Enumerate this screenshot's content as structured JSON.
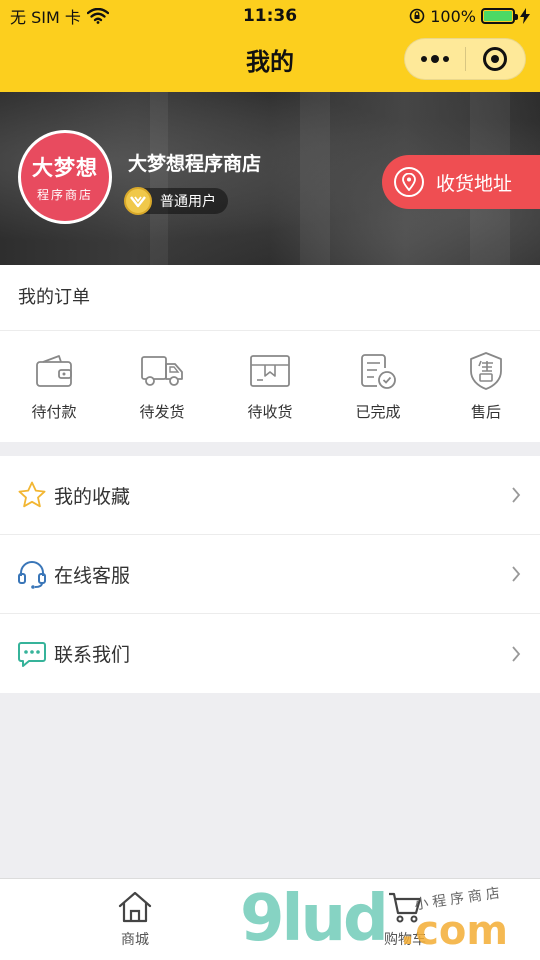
{
  "status_bar": {
    "carrier": "无 SIM 卡",
    "time": "11:36",
    "battery": "100%"
  },
  "nav": {
    "title": "我的"
  },
  "profile": {
    "avatar_line1": "大梦想",
    "avatar_line2": "程序商店",
    "name": "大梦想程序商店",
    "level": "普通用户",
    "address_button": "收货地址"
  },
  "orders": {
    "title": "我的订单",
    "items": [
      {
        "label": "待付款",
        "icon": "wallet-icon"
      },
      {
        "label": "待发货",
        "icon": "truck-icon"
      },
      {
        "label": "待收货",
        "icon": "package-icon"
      },
      {
        "label": "已完成",
        "icon": "completed-doc-icon"
      },
      {
        "label": "售后",
        "icon": "after-sales-shield-icon"
      }
    ]
  },
  "menu": {
    "items": [
      {
        "label": "我的收藏",
        "icon": "star-icon"
      },
      {
        "label": "在线客服",
        "icon": "headset-icon"
      },
      {
        "label": "联系我们",
        "icon": "chat-bubble-icon"
      }
    ]
  },
  "tabbar": {
    "items": [
      {
        "label": "商城",
        "icon": "home-icon"
      },
      {
        "label": "购物车",
        "icon": "cart-icon"
      }
    ]
  },
  "watermark": {
    "main": "9lud",
    "domain": ".com",
    "tagline": "小程序商店"
  },
  "colors": {
    "header": "#fccf1e",
    "accent_red": "#ef4e52",
    "avatar_bg": "#e84b5f",
    "star": "#f2b632",
    "headset": "#3a76b8",
    "chat": "#36b39a"
  }
}
